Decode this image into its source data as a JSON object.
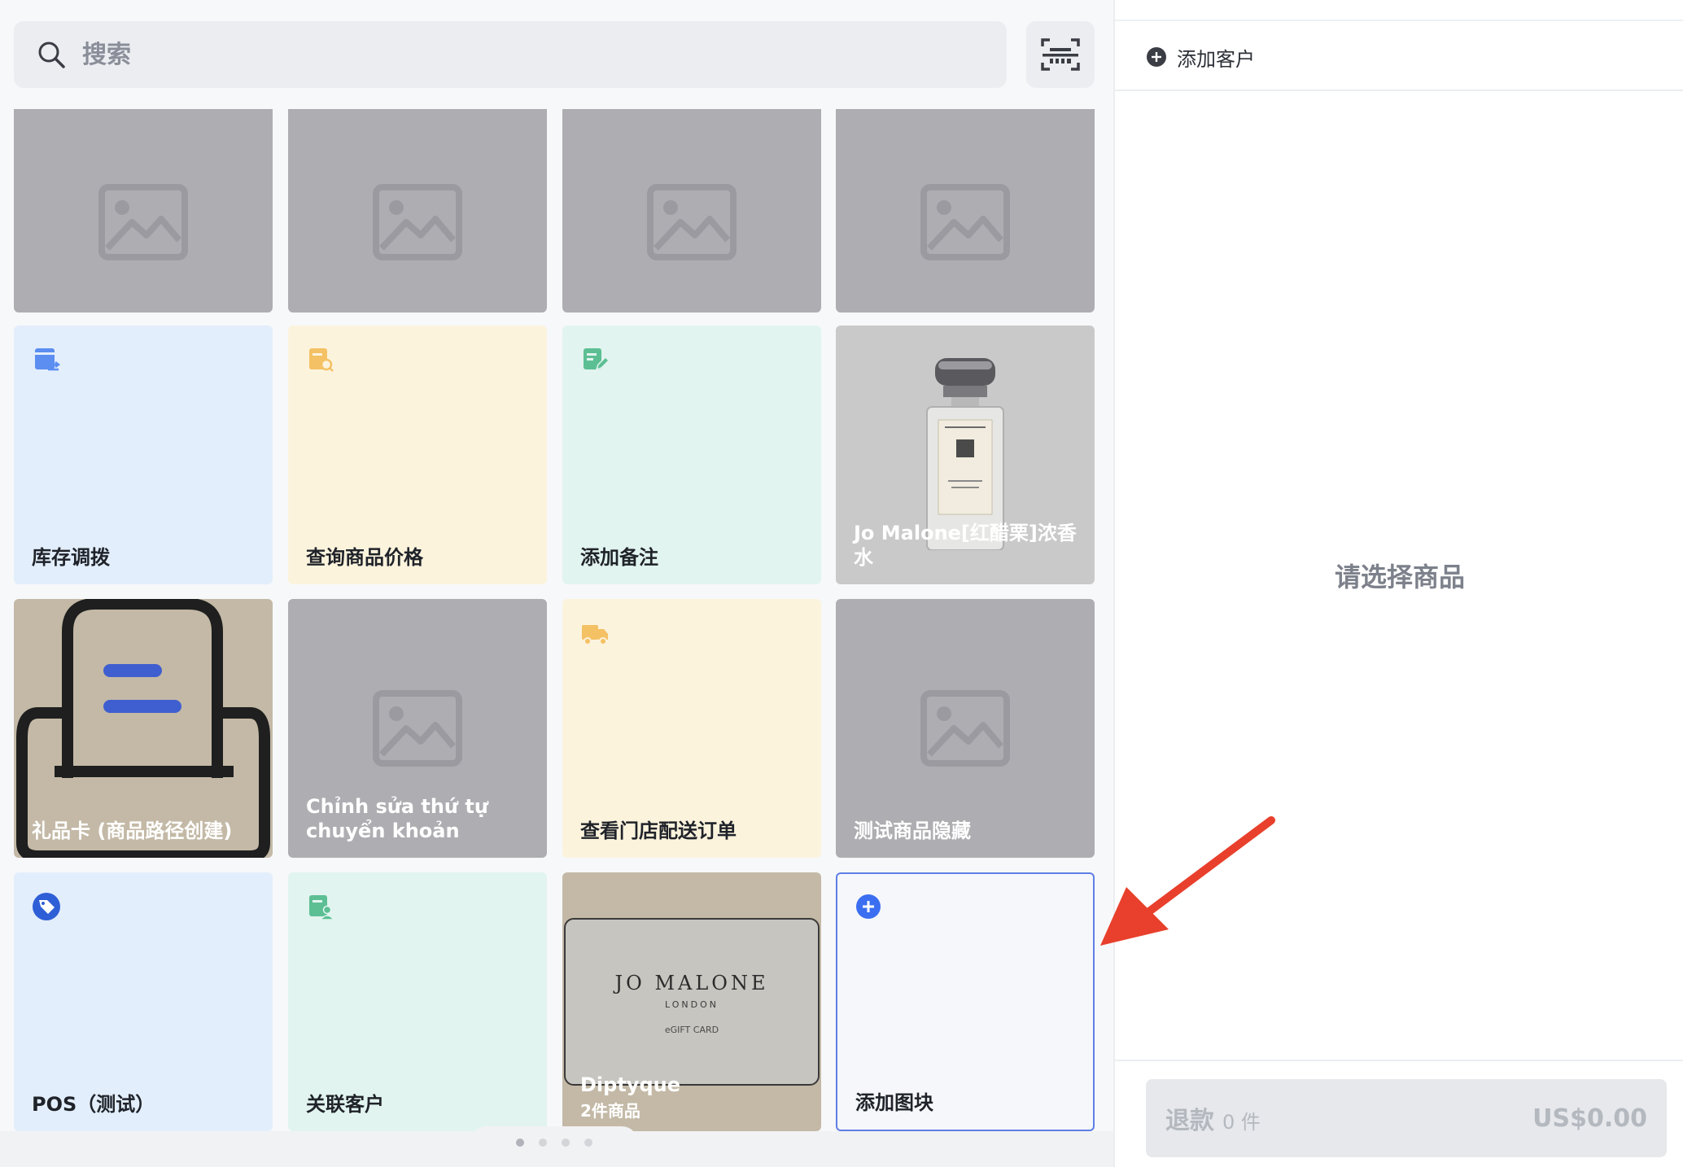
{
  "search": {
    "placeholder": "搜索"
  },
  "tiles": [
    {
      "label": ""
    },
    {
      "label": ""
    },
    {
      "label": ""
    },
    {
      "label": ""
    },
    {
      "label": "库存调拨"
    },
    {
      "label": "查询商品价格"
    },
    {
      "label": "添加备注"
    },
    {
      "label": "Jo Malone[红醋栗]浓香水"
    },
    {
      "label": "礼品卡 (商品路径创建)"
    },
    {
      "label": "Chỉnh sửa thứ tự chuyển khoản"
    },
    {
      "label": "查看门店配送订单"
    },
    {
      "label": "测试商品隐藏"
    },
    {
      "label": "POS（测试）"
    },
    {
      "label": "关联客户"
    },
    {
      "label": "Diptyque",
      "sublabel": "2件商品",
      "card_brand": "JO MALONE",
      "card_city": "LONDON",
      "card_type": "eGIFT CARD"
    },
    {
      "label": "添加图块"
    }
  ],
  "pager": {
    "pages": 4,
    "active": 0
  },
  "cart": {
    "add_customer": "添加客户",
    "empty_text": "请选择商品",
    "refund_label": "退款",
    "refund_count": "0 件",
    "refund_amount": "US$0.00"
  },
  "colors": {
    "accent": "#3b6ef0",
    "annotation_arrow": "#e8402c"
  }
}
